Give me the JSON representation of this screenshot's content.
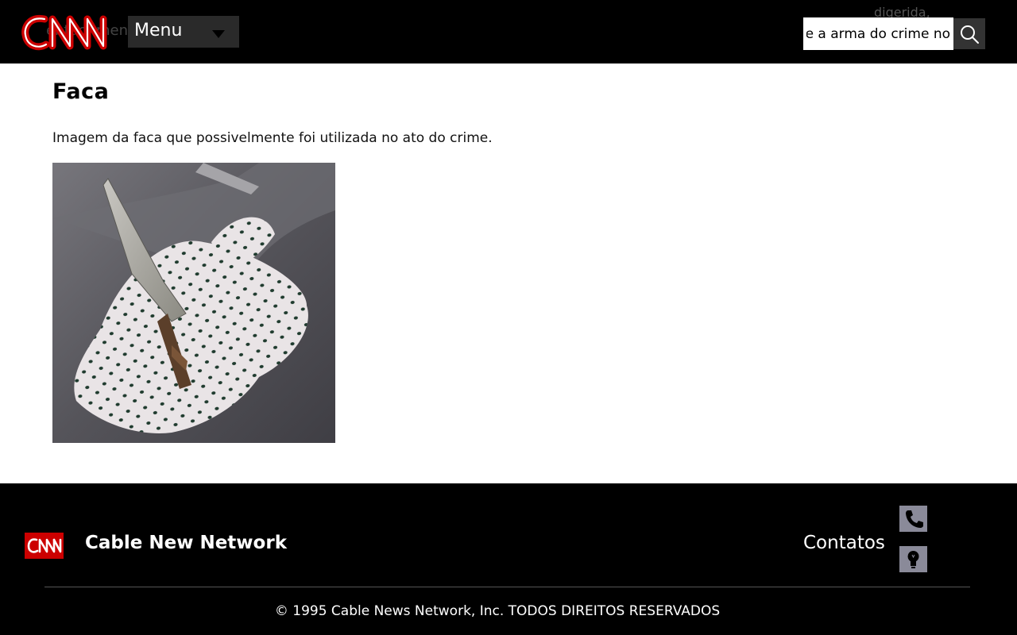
{
  "header": {
    "logo_text": "CNN",
    "menu_label": "Menu",
    "ghost_text_left": "então, mentiu disse que",
    "ghost_text_right_top": "digerida,",
    "search_value": "e a arma do crime no",
    "search_icon": "search-icon",
    "menu_icon": "caret-down-icon"
  },
  "main": {
    "title": "Faca",
    "description": "Imagem da faca que possivelmente foi utilizada no ato do crime.",
    "image_alt": "knife-photo"
  },
  "footer": {
    "logo_text": "CNN",
    "brand": "Cable New Network",
    "contacts_label": "Contatos",
    "phone_icon": "phone-icon",
    "bulb_icon": "lightbulb-icon",
    "copyright": "© 1995 Cable News Network, Inc. TODOS DIREITOS RESERVADOS"
  },
  "colors": {
    "header_bg": "#000000",
    "brand_red": "#cc0000",
    "footer_bg": "#000000",
    "icon_button_bg": "#8a8a99"
  }
}
